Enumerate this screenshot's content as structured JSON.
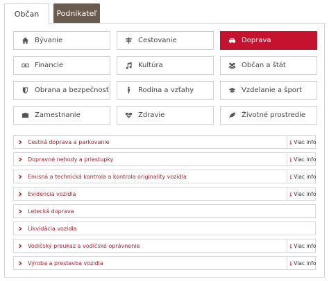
{
  "tabs": [
    {
      "label": "Občan",
      "active": true
    },
    {
      "label": "Podnikateľ",
      "active": false
    }
  ],
  "categories": [
    {
      "label": "Bývanie",
      "icon": "home-icon"
    },
    {
      "label": "Cestovanie",
      "icon": "signpost-icon"
    },
    {
      "label": "Doprava",
      "icon": "car-icon",
      "active": true
    },
    {
      "label": "Financie",
      "icon": "money-icon"
    },
    {
      "label": "Kultúra",
      "icon": "music-icon"
    },
    {
      "label": "Občan a štát",
      "icon": "users-icon"
    },
    {
      "label": "Obrana a bezpečnosť",
      "icon": "shield-icon"
    },
    {
      "label": "Rodina a vzťahy",
      "icon": "family-icon"
    },
    {
      "label": "Vzdelanie a šport",
      "icon": "graduation-cap-icon"
    },
    {
      "label": "Zamestnanie",
      "icon": "briefcase-icon"
    },
    {
      "label": "Zdravie",
      "icon": "heartbeat-icon"
    },
    {
      "label": "Životné prostredie",
      "icon": "leaf-icon"
    }
  ],
  "subtopics": [
    {
      "label": "Cestná doprava a parkovanie",
      "has_more": true
    },
    {
      "label": "Dopravné nehody a priestupky",
      "has_more": true
    },
    {
      "label": "Emisná a technická kontrola a kontrola originality vozidla",
      "has_more": true
    },
    {
      "label": "Evidencia vozidla",
      "has_more": true
    },
    {
      "label": "Letecká doprava",
      "has_more": false
    },
    {
      "label": "Likvidácia vozidla",
      "has_more": false
    },
    {
      "label": "Vodičský preukaz a vodičské oprávnenie",
      "has_more": true
    },
    {
      "label": "Výroba a prestavba vozidla",
      "has_more": true
    }
  ],
  "more_label": "Viac info",
  "colors": {
    "accent": "#c4122f",
    "tab_inactive": "#6b5a4e",
    "link": "#b01a2c"
  }
}
